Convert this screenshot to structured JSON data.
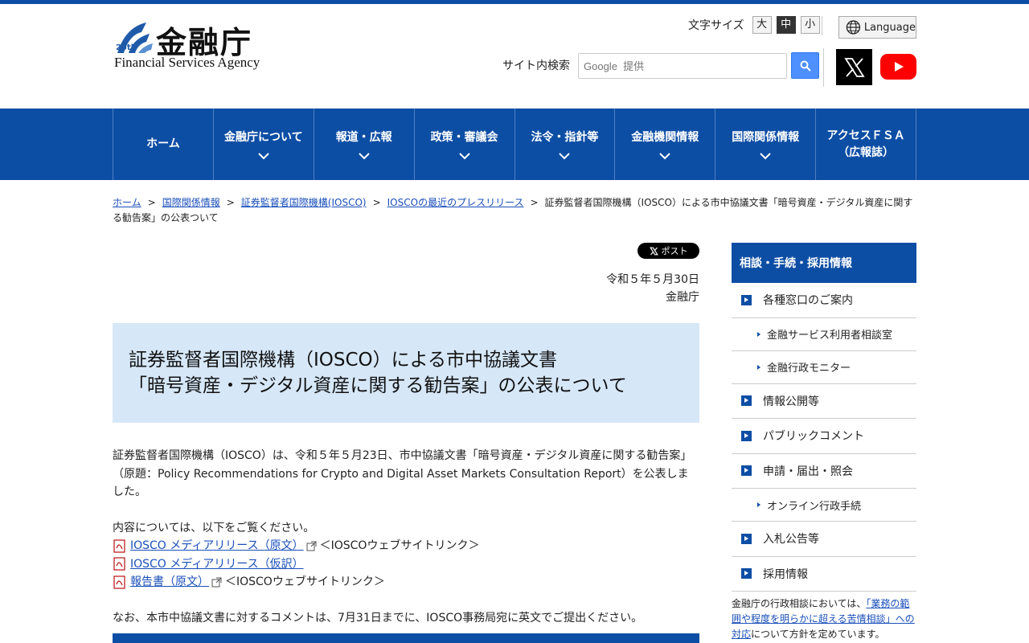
{
  "header": {
    "logo_title": "金融庁",
    "logo_en": "Financial Services Agency",
    "logo_25": "25th",
    "font_size_label": "文字サイズ",
    "font_sizes": [
      "大",
      "中",
      "小"
    ],
    "language_label": "Language",
    "search_label": "サイト内検索",
    "search_placeholder": "Google  提供"
  },
  "nav": [
    "ホーム",
    "金融庁について",
    "報道・広報",
    "政策・審議会",
    "法令・指針等",
    "金融機関情報",
    "国際関係情報",
    "アクセスＦＳＡ（広報誌）"
  ],
  "nav_access_line1": "アクセスＦＳＡ",
  "nav_access_line2": "（広報誌）",
  "breadcrumb": {
    "items": [
      "ホーム",
      "国際関係情報",
      "証券監督者国際機構(IOSCO)",
      "IOSCOの最近のプレスリリース"
    ],
    "current": "証券監督者国際機構（IOSCO）による市中協議文書「暗号資産・デジタル資産に関する勧告案」の公表ついて"
  },
  "post_label": "ポスト",
  "date": "令和５年５月30日",
  "agency": "金融庁",
  "title_line1": "証券監督者国際機構（IOSCO）による市中協議文書",
  "title_line2": "「暗号資産・デジタル資産に関する勧告案」の公表について",
  "body": {
    "para1": "証券監督者国際機構（IOSCO）は、令和５年５月23日、市中協議文書「暗号資産・デジタル資産に関する勧告案」（原題：Policy Recommendations for Crypto and Digital Asset Markets Consultation Report）を公表しました。",
    "intro": "内容については、以下をご覧ください。",
    "links": [
      {
        "text": "IOSCO メディアリリース（原文）",
        "suffix": "＜IOSCOウェブサイトリンク＞"
      },
      {
        "text": "IOSCO メディアリリース（仮訳）",
        "suffix": ""
      },
      {
        "text": "報告書（原文）",
        "suffix": "＜IOSCOウェブサイトリンク＞"
      }
    ],
    "note": "なお、本市中協議文書に対するコメントは、7月31日までに、IOSCO事務局宛に英文でご提出ください。"
  },
  "sidebar": {
    "heading": "相談・手続・採用情報",
    "items": [
      "各種窓口のご案内",
      "金融サービス利用者相談室",
      "金融行政モニター",
      "情報公開等",
      "パブリックコメント",
      "申請・届出・照会",
      "オンライン行政手続",
      "入札公告等",
      "採用情報"
    ],
    "note_prefix": "金融庁の行政相談においては、",
    "note_link": "「業務の範囲や程度を明らかに超える苦情相談」への対応",
    "note_suffix": "について方針を定めています。"
  }
}
